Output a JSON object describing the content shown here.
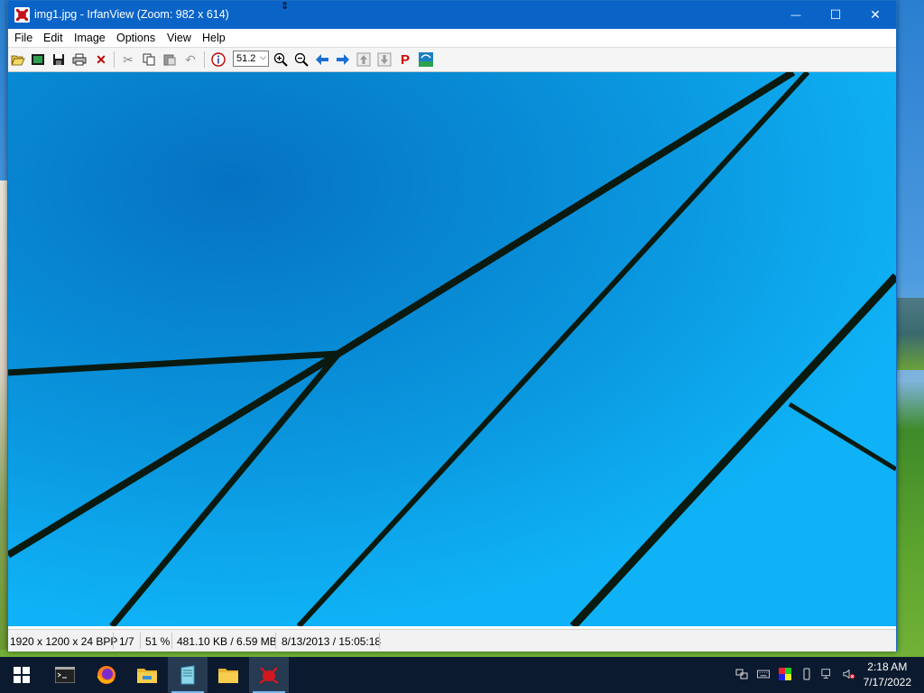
{
  "window": {
    "title": "img1.jpg - IrfanView (Zoom: 982 x 614)",
    "controls": {
      "minimize": "—",
      "maximize": "☐",
      "close": "✕"
    }
  },
  "menu": [
    "File",
    "Edit",
    "Image",
    "Options",
    "View",
    "Help"
  ],
  "toolbar": {
    "buttons": [
      "open-icon",
      "slideshow-icon",
      "save-icon",
      "print-icon",
      "delete-icon",
      "cut-icon",
      "copy-icon",
      "paste-icon",
      "undo-icon",
      "info-icon",
      "zoom-in-icon",
      "zoom-out-icon",
      "previous-icon",
      "next-icon",
      "first-icon",
      "last-icon",
      "paint-icon",
      "irfanview-logo-icon"
    ],
    "zoom_value": "51.2"
  },
  "status": {
    "dimensions": "1920 x 1200 x 24 BPP",
    "index": "1/7",
    "zoom": "51 %",
    "size": "481.10 KB / 6.59 MB",
    "date": "8/13/2013 / 15:05:18"
  },
  "taskbar": {
    "items": [
      "start-icon",
      "terminal-icon",
      "firefox-icon",
      "file-explorer-icon",
      "notepad-icon",
      "folder-icon",
      "irfanview-icon"
    ],
    "tray": [
      "network-icon",
      "keyboard-icon",
      "color-icon",
      "usb-icon",
      "network-wired-icon",
      "volume-muted-icon"
    ],
    "time": "2:18 AM",
    "date": "7/17/2022"
  },
  "colors": {
    "titlebar": "#0a64c8",
    "image_bg": "#0aa3ec",
    "taskbar": "#0b1a2f"
  }
}
